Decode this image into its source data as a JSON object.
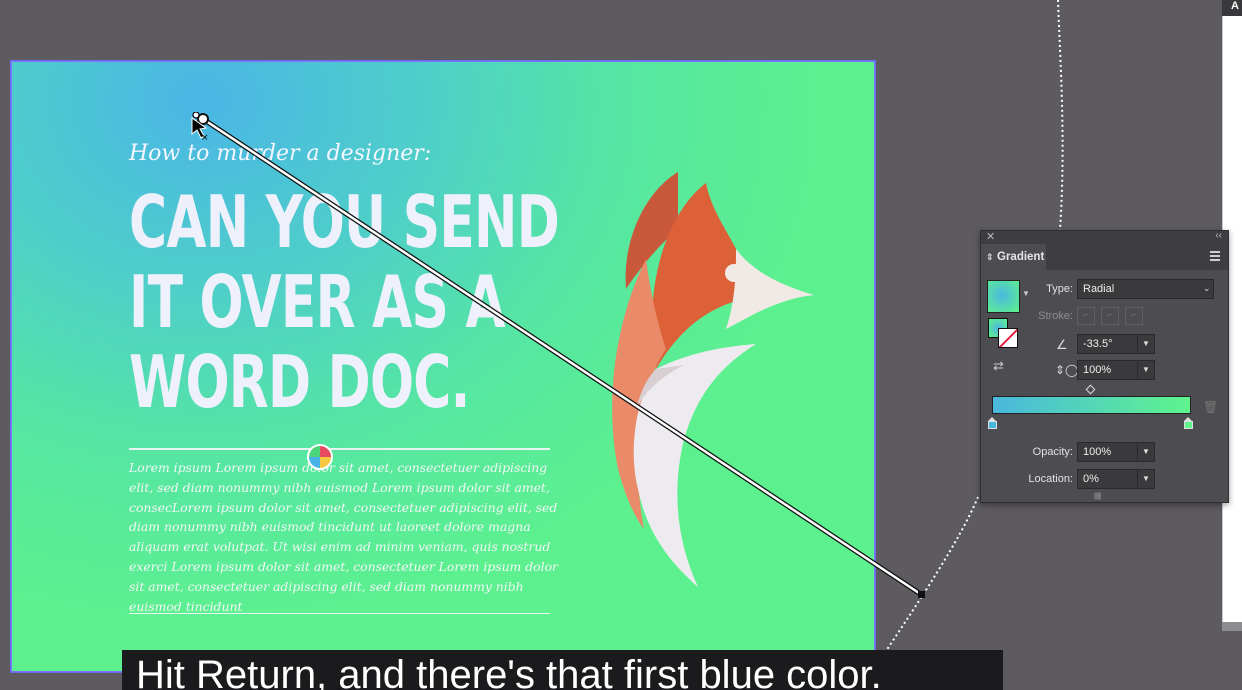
{
  "artboard": {
    "subtitle": "How to murder a designer:",
    "headline": [
      "CAN YOU SEND",
      "IT OVER AS A",
      "WORD DOC."
    ],
    "body": "Lorem ipsum Lorem ipsum dolor sit amet, consectetuer adipiscing elit, sed diam nonummy nibh euismod Lorem ipsum dolor sit amet, consecLorem ipsum dolor sit amet, consectetuer adipiscing elit, sed diam nonummy nibh euismod tincidunt ut laoreet dolore magna aliquam erat volutpat. Ut wisi enim ad minim veniam, quis nostrud exerci Lorem ipsum dolor sit amet, consectetuer Lorem ipsum dolor sit amet, consectetuer adipiscing elit, sed diam nonummy nibh euismod tincidunt"
  },
  "gradient_panel": {
    "tab_label": "Gradient",
    "type_label": "Type:",
    "type_value": "Radial",
    "stroke_label": "Stroke:",
    "angle_value": "-33.5°",
    "aspect_value": "100%",
    "opacity_label": "Opacity:",
    "opacity_value": "100%",
    "location_label": "Location:",
    "location_value": "0%",
    "colors": {
      "start": "#49b8de",
      "end": "#5ff48d"
    }
  },
  "right_panel": {
    "header": "A"
  },
  "caption": {
    "text": "Hit Return, and there's that first blue color."
  },
  "icons": [
    "close-icon",
    "collapse-icon",
    "panel-menu-icon",
    "angle-icon",
    "aspect-ratio-icon",
    "delete-stop-icon",
    "color-wheel-icon",
    "selection-cursor-icon"
  ]
}
